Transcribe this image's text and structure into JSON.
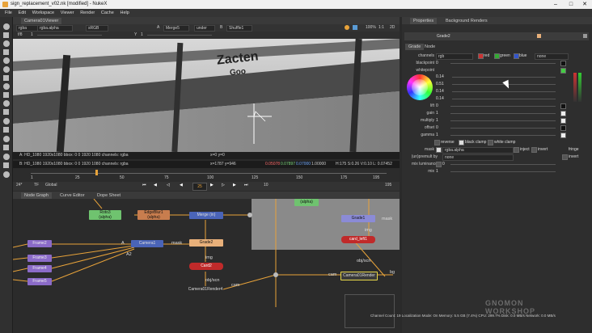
{
  "window": {
    "title": "sign_replacement_v02.nk [modified] - NukeX"
  },
  "menu": [
    "File",
    "Edit",
    "Workspace",
    "Viewer",
    "Render",
    "Cache",
    "Help"
  ],
  "viewer": {
    "tab": "Camera01Viewer",
    "row1": {
      "channels": "rgba",
      "layer": "rgba.alpha",
      "colorspace": "sRGB",
      "input_a": "A",
      "node_a": "Merge5",
      "op": "under",
      "input_b": "B",
      "node_b": "Shuffle1",
      "zoom": "100%",
      "fraction": "1:1",
      "mode": "2D"
    },
    "row2": {
      "gain_label": "f/8",
      "gain_value": "1",
      "y_label": "Y",
      "y_value": "1"
    },
    "info1": {
      "a": "A:  HD_1080 1920x1080  bbox: 0 0 1920 1080 channels: rgba",
      "xy": "x=0 y=0"
    },
    "info2": {
      "b": "B:  HD_1080 1920x1080  bbox: 0 0 1920 1080 channels: rgba",
      "xy": "x=1787 y=946",
      "r": "0.05078",
      "g": "0.07897",
      "b_val": "0.07000",
      "a_val": "1.00000",
      "hsv": "H:175 S:0.26 V:0.10  L: 0.07452"
    },
    "sign": {
      "word1": "Zacten",
      "word2": "Goo"
    }
  },
  "timeline": {
    "ticks": [
      "1",
      "25",
      "50",
      "75",
      "100",
      "125",
      "150",
      "175",
      "195"
    ],
    "fps": "24*",
    "tf": "TF",
    "range": "Global",
    "frame": "25",
    "increment": "10",
    "end": "195"
  },
  "nodegraph": {
    "tabs": [
      "Node Graph",
      "Curve Editor",
      "Dope Sheet"
    ],
    "nodes": {
      "roto": "Roto3",
      "roto_sub": "(alpha)",
      "edgeblur": "EdgeBlur1",
      "edgeblur_sub": "(alpha)",
      "merge": "Merge (in)",
      "grade2": "Grade2",
      "card2": "Card2",
      "scanline2": "Camera01Render4",
      "grade1": "Grade1",
      "card1": "card_left1",
      "scanline1": "Camera01Render",
      "alpha": "(alpha)",
      "frame1": "Frame2",
      "frame2": "Frame3",
      "frame3": "Frame4",
      "frame4": "Frame5",
      "cam": "Camera1"
    },
    "labels": {
      "a": "A",
      "a2": "A2",
      "mask": "mask",
      "mask2": "mask",
      "img": "img",
      "img2": "img",
      "cam": "cam",
      "cam2": "cam",
      "obj": "obj/scn",
      "obj2": "obj/scn",
      "bg": "bg"
    }
  },
  "panel": {
    "tabs": [
      "Properties",
      "Background Renders"
    ],
    "node_name": "Grade2",
    "subtabs": [
      "Grade",
      "Node"
    ],
    "channels": {
      "label": "channels",
      "value": "rgb",
      "red": "red",
      "green": "green",
      "blue": "blue",
      "none": "none"
    },
    "params": [
      {
        "label": "blackpoint",
        "value": "0"
      },
      {
        "label": "whitepoint",
        "value": ""
      },
      {
        "label": "lift",
        "value": "0"
      },
      {
        "label": "gain",
        "value": "1"
      },
      {
        "label": "multiply",
        "value": "1"
      },
      {
        "label": "offset",
        "value": "0"
      },
      {
        "label": "gamma",
        "value": "1"
      }
    ],
    "wheel_values": [
      "0.14",
      "0.51",
      "0.14",
      "0.14"
    ],
    "options": {
      "reverse": "reverse",
      "black_clamp": "black clamp",
      "white_clamp": "white clamp"
    },
    "mask": {
      "label": "mask",
      "value": "rgba.alpha",
      "inject": "inject",
      "invert": "invert",
      "fringe": "fringe"
    },
    "unpremult": {
      "label": "(un)premult by",
      "value": "none",
      "invert": "invert"
    },
    "mix_lum": {
      "label": "mix luminance",
      "value": "0"
    },
    "mix": {
      "label": "mix",
      "value": "1"
    }
  },
  "status": "Channel Count: 19  Localization Mode: On  Memory: 5.5 GB (7.4%)  CPU: 299.7%  Disk: 0.0 MB/s  Network: 0.0 MB/s",
  "watermark": {
    "line1": "GNOMON",
    "line2": "WORKSHOP"
  }
}
